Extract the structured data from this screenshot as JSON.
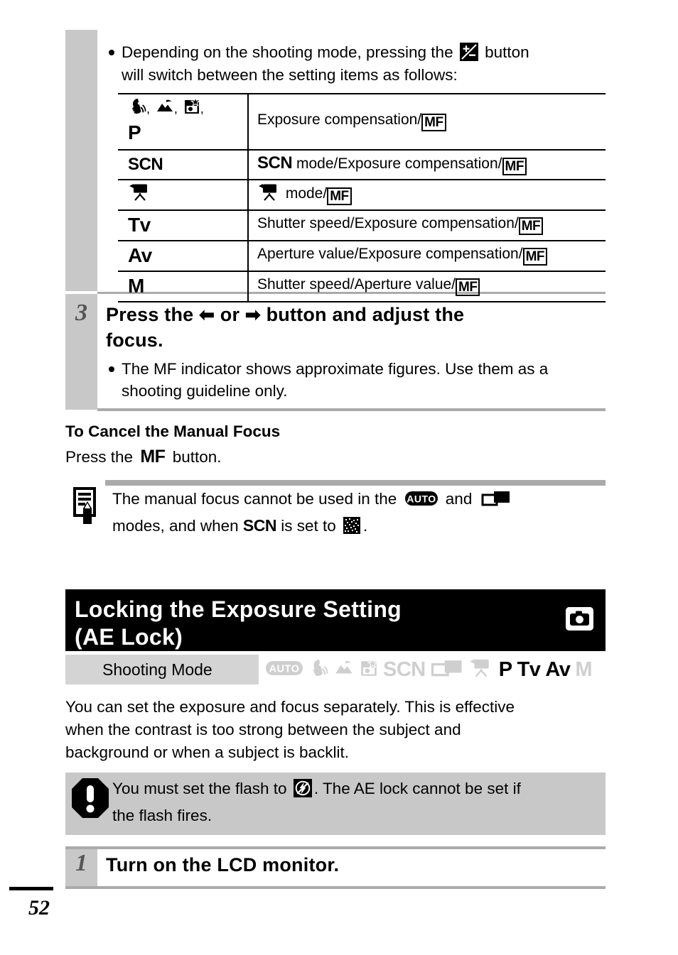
{
  "page": {
    "number": "52"
  },
  "note_bullet": {
    "text_before_icon": "Depending on the shooting mode, pressing the",
    "icon": "exposure-compensation-icon",
    "text_after_icon": "button",
    "line2": "will switch between the setting items as follows:"
  },
  "mode_table": {
    "rows": [
      {
        "mode_icons": [
          "portrait-icon",
          "landscape-icon",
          "night-snapshot-icon"
        ],
        "mode_label": "P",
        "separator": ",",
        "description": "Exposure compensation/",
        "description_icon": "mf-boxed-icon"
      },
      {
        "mode_icons": [],
        "mode_label": "SCN",
        "description_prefix": "SCN",
        "description": " mode/Exposure compensation/",
        "description_icon": "mf-boxed-icon"
      },
      {
        "mode_icons": [
          "movie-icon"
        ],
        "mode_label": "",
        "description_prefix_icon": "movie-icon",
        "description": " mode/",
        "description_icon": "mf-boxed-icon"
      },
      {
        "mode_icons": [],
        "mode_label": "Tv",
        "description": "Shutter speed/Exposure compensation/",
        "description_icon": "mf-boxed-icon"
      },
      {
        "mode_icons": [],
        "mode_label": "Av",
        "description": "Aperture value/Exposure compensation/",
        "description_icon": "mf-boxed-icon"
      },
      {
        "mode_icons": [],
        "mode_label": "M",
        "description": "Shutter speed/Aperture value/",
        "description_icon": "mf-boxed-icon"
      }
    ]
  },
  "step3": {
    "number": "3",
    "heading_part1": "Press the",
    "heading_left_arrow": "left-arrow-icon",
    "heading_or": "or",
    "heading_right_arrow": "right-arrow-icon",
    "heading_part2": "button and adjust the",
    "heading_line2": "focus.",
    "bullet_line1": "The MF indicator shows approximate figures. Use them as a",
    "bullet_line2": "shooting guideline only."
  },
  "cancel_section": {
    "heading": "To Cancel the Manual Focus",
    "text_before": "Press the",
    "icon": "mf-icon",
    "text_after": "button."
  },
  "memo_note": {
    "icon": "memo-note-icon",
    "line1_a": "The manual focus cannot be used in the",
    "line1_icon": "auto-mode-icon",
    "line1_b": "and",
    "line1_icon2": "stitch-assist-icon",
    "line2_a": "modes, and when",
    "line2_scn": "SCN",
    "line2_b": "is set to",
    "line2_icon": "fireworks-scene-icon",
    "line2_c": "."
  },
  "section": {
    "title_line1": "Locking the Exposure Setting",
    "title_line2": "(AE Lock)",
    "badge_icon": "camera-icon"
  },
  "shooting_mode_strip": {
    "label": "Shooting Mode",
    "icons": [
      {
        "name": "auto-mode-icon",
        "type": "icon",
        "active": false
      },
      {
        "name": "portrait-mode-icon",
        "type": "icon",
        "active": false
      },
      {
        "name": "landscape-mode-icon",
        "type": "icon",
        "active": false
      },
      {
        "name": "night-snapshot-mode-icon",
        "type": "icon",
        "active": false
      },
      {
        "name": "scn-mode-label",
        "type": "text",
        "text": "SCN",
        "active": false
      },
      {
        "name": "stitch-assist-mode-icon",
        "type": "icon",
        "active": false
      },
      {
        "name": "movie-mode-icon",
        "type": "icon",
        "active": false
      },
      {
        "name": "program-mode-label",
        "type": "text",
        "text": "P",
        "active": true
      },
      {
        "name": "tv-mode-label",
        "type": "text",
        "text": "Tv",
        "active": true
      },
      {
        "name": "av-mode-label",
        "type": "text",
        "text": "Av",
        "active": true
      },
      {
        "name": "manual-mode-label",
        "type": "text",
        "text": "M",
        "active": false
      }
    ]
  },
  "intro": {
    "line1": "You can set the exposure and focus separately. This is effective",
    "line2": "when the contrast is too strong between the subject and",
    "line3": "background or when a subject is backlit."
  },
  "caution": {
    "icon": "caution-exclamation-icon",
    "line1_a": "You must set the flash to",
    "line1_icon": "flash-off-icon",
    "line1_b": ". The AE lock cannot be set if",
    "line2": "the flash fires."
  },
  "step1": {
    "number": "1",
    "heading": "Turn on the LCD monitor."
  },
  "colors": {
    "rail_gray": "#c8c8c8",
    "panel_gray": "#c8c8c8",
    "rule_gray": "#aaaaaa",
    "strip_label_gray": "#d4d4d4",
    "inactive_icon_gray": "#cfcfcf",
    "band_black": "#000000"
  }
}
